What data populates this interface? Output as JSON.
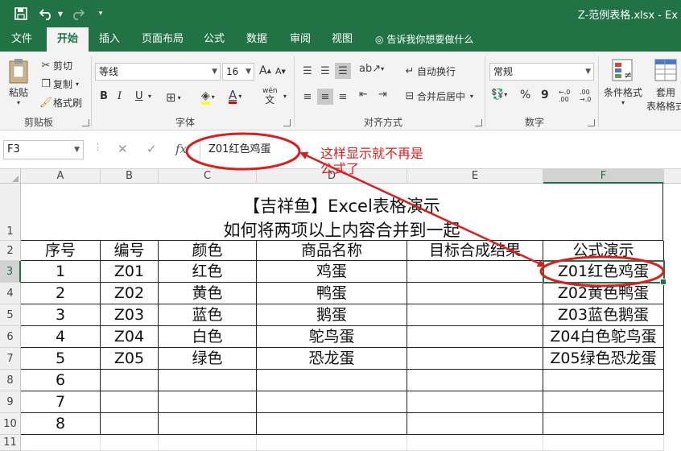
{
  "titlebar": {
    "file_title": "Z-范例表格.xlsx - Ex",
    "save_icon": "save-icon",
    "undo_icon": "undo-icon",
    "redo_icon": "redo-icon"
  },
  "tabs": [
    "文件",
    "开始",
    "插入",
    "页面布局",
    "公式",
    "数据",
    "审阅",
    "视图"
  ],
  "tell_me": "告诉我你想要做什么",
  "ribbon": {
    "clipboard": {
      "paste": "粘贴",
      "cut": "剪切",
      "copy": "复制",
      "format_painter": "格式刷",
      "label": "剪贴板"
    },
    "font": {
      "name": "等线",
      "size": "16",
      "label": "字体",
      "wen": "wén",
      "wen_char": "文",
      "bold": "B",
      "italic": "I",
      "underline": "U",
      "grow": "A",
      "shrink": "A",
      "color_a": "A"
    },
    "align": {
      "wrap": "自动换行",
      "merge": "合并后居中",
      "label": "对齐方式"
    },
    "number": {
      "format": "常规",
      "label": "数字",
      "percent": "%",
      "comma": "9",
      "inc": "←.0 .00",
      "dec": ".00 →.0"
    },
    "styles": {
      "conditional": "条件格式",
      "table_l1": "套用",
      "table_l2": "表格格式"
    }
  },
  "formula_bar": {
    "name_box": "F3",
    "formula": "Z01红色鸡蛋",
    "cancel": "✕",
    "enter": "✓",
    "fx": "fx"
  },
  "columns": [
    "A",
    "B",
    "C",
    "D",
    "E",
    "F"
  ],
  "rows": [
    "1",
    "2",
    "3",
    "4",
    "5",
    "6",
    "7",
    "8",
    "9",
    "10",
    "11"
  ],
  "sheet": {
    "title_line1": "【吉祥鱼】Excel表格演示",
    "title_line2": "如何将两项以上内容合并到一起",
    "headers": [
      "序号",
      "编号",
      "颜色",
      "商品名称",
      "目标合成结果",
      "公式演示"
    ],
    "data": [
      [
        "1",
        "Z01",
        "红色",
        "鸡蛋",
        "",
        "Z01红色鸡蛋"
      ],
      [
        "2",
        "Z02",
        "黄色",
        "鸭蛋",
        "",
        "Z02黄色鸭蛋"
      ],
      [
        "3",
        "Z03",
        "蓝色",
        "鹅蛋",
        "",
        "Z03蓝色鹅蛋"
      ],
      [
        "4",
        "Z04",
        "白色",
        "鸵鸟蛋",
        "",
        "Z04白色鸵鸟蛋"
      ],
      [
        "5",
        "Z05",
        "绿色",
        "恐龙蛋",
        "",
        "Z05绿色恐龙蛋"
      ],
      [
        "6",
        "",
        "",
        "",
        "",
        ""
      ],
      [
        "7",
        "",
        "",
        "",
        "",
        ""
      ],
      [
        "8",
        "",
        "",
        "",
        "",
        ""
      ]
    ]
  },
  "annotation": {
    "line1": "这样显示就不再是",
    "line2": "公式了"
  },
  "colors": {
    "excel_green": "#217346",
    "annotation_red": "#d9201f"
  }
}
